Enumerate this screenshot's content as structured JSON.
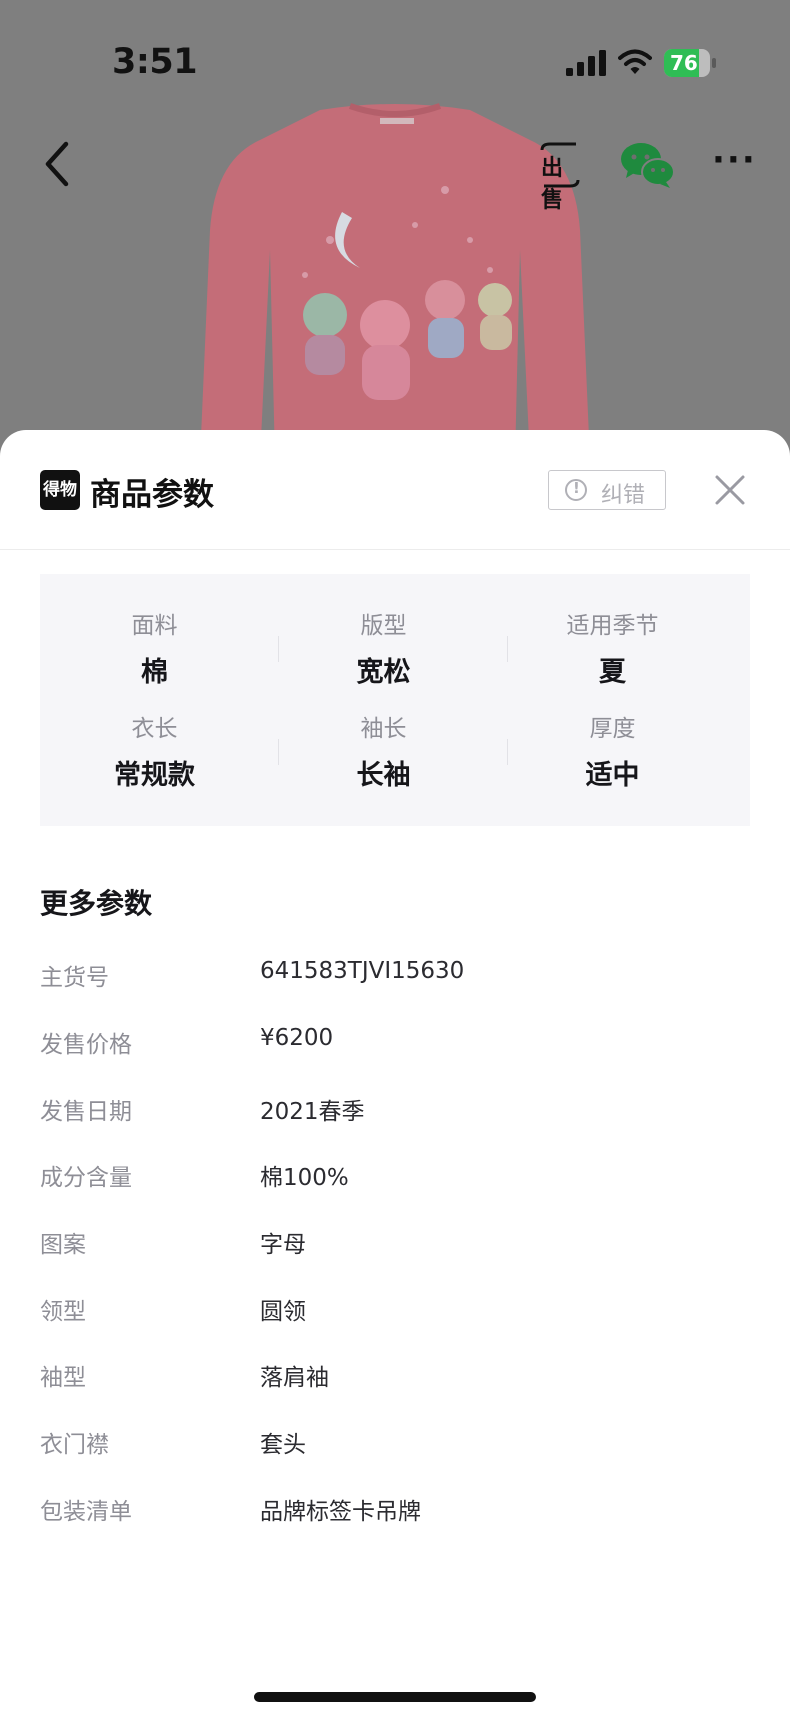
{
  "status_bar": {
    "time": "3:51",
    "battery": "76",
    "battery_level": 0.76
  },
  "nav": {
    "sell_label": "出售"
  },
  "sheet": {
    "logo_text": "得物",
    "title": "商品参数",
    "report_label": "纠错",
    "key_params": [
      {
        "label": "面料",
        "value": "棉"
      },
      {
        "label": "版型",
        "value": "宽松"
      },
      {
        "label": "适用季节",
        "value": "夏"
      },
      {
        "label": "衣长",
        "value": "常规款"
      },
      {
        "label": "袖长",
        "value": "长袖"
      },
      {
        "label": "厚度",
        "value": "适中"
      }
    ],
    "more_title": "更多参数",
    "more_params": [
      {
        "key": "主货号",
        "value": "641583TJVI15630"
      },
      {
        "key": "发售价格",
        "value": "¥6200"
      },
      {
        "key": "发售日期",
        "value": "2021春季"
      },
      {
        "key": "成分含量",
        "value": "棉100%"
      },
      {
        "key": "图案",
        "value": "字母"
      },
      {
        "key": "领型",
        "value": "圆领"
      },
      {
        "key": "袖型",
        "value": "落肩袖"
      },
      {
        "key": "衣门襟",
        "value": "套头"
      },
      {
        "key": "包装清单",
        "value": "品牌标签卡吊牌"
      }
    ]
  },
  "colors": {
    "overlay": "#7f7f7f",
    "product_pink": "#c9707a",
    "battery_green": "#2fbd55",
    "wechat_green": "#1f8a3e",
    "key_params_bg": "#f6f6f9"
  }
}
